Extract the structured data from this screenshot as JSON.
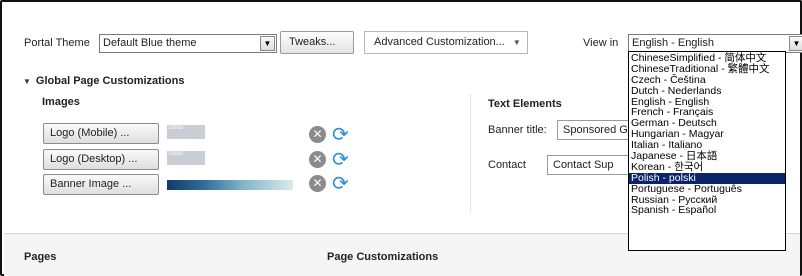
{
  "toolbar": {
    "portal_theme_label": "Portal Theme",
    "theme_value": "Default Blue theme",
    "tweaks_label": "Tweaks...",
    "advanced_label": "Advanced Customization...",
    "view_in_label": "View in",
    "view_in_value": "English - English"
  },
  "global": {
    "title": "Global Page Customizations",
    "images_title": "Images",
    "logo_mobile_label": "Logo (Mobile) ...",
    "logo_desktop_label": "Logo (Desktop) ...",
    "banner_label": "Banner Image ...",
    "logo_thumb_text": "cisco"
  },
  "text_elements": {
    "title": "Text Elements",
    "banner_title_label": "Banner title:",
    "banner_title_value": "Sponsored G",
    "contact_label": "Contact",
    "contact_value": "Contact Sup"
  },
  "bottom": {
    "pages_title": "Pages",
    "page_customizations_title": "Page Customizations"
  },
  "language_dropdown": {
    "selected_index": 11,
    "options": [
      "ChineseSimplified - 简体中文",
      "ChineseTraditional - 繁體中文",
      "Czech - Čeština",
      "Dutch - Nederlands",
      "English - English",
      "French - Français",
      "German - Deutsch",
      "Hungarian - Magyar",
      "Italian - Italiano",
      "Japanese - 日本語",
      "Korean - 한국어",
      "Polish - polski",
      "Portuguese - Português",
      "Russian - Русский",
      "Spanish - Español"
    ]
  },
  "colors": {
    "selection_bg": "#0a246a",
    "reset_icon": "#2a8fd4",
    "remove_icon": "#8b8b8b"
  },
  "icons": {
    "remove": "close-circle-icon",
    "reset": "refresh-icon",
    "collapse": "triangle-down-icon",
    "select_arrow": "chevron-down-icon"
  }
}
